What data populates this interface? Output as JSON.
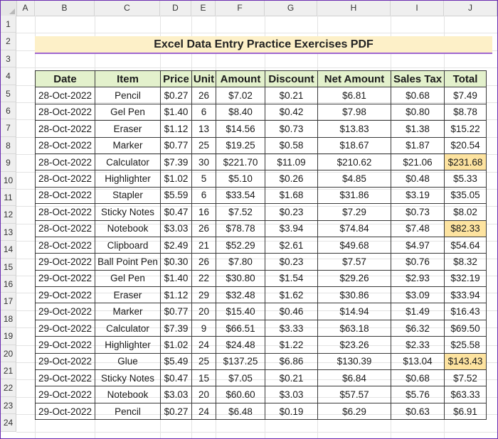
{
  "sheet": {
    "columns": [
      "A",
      "B",
      "C",
      "D",
      "E",
      "F",
      "G",
      "H",
      "I",
      "J"
    ],
    "rows": [
      "1",
      "2",
      "3",
      "4",
      "5",
      "6",
      "7",
      "8",
      "9",
      "10",
      "11",
      "12",
      "13",
      "14",
      "15",
      "16",
      "17",
      "18",
      "19",
      "20",
      "21",
      "22",
      "23",
      "24"
    ]
  },
  "title": "Excel Data Entry Practice Exercises PDF",
  "table": {
    "headers": [
      "Date",
      "Item",
      "Price",
      "Unit",
      "Amount",
      "Discount",
      "Net Amount",
      "Sales Tax",
      "Total"
    ],
    "highlight_color": "#fde3a0",
    "header_color": "#e3f1cc",
    "rows": [
      [
        "28-Oct-2022",
        "Pencil",
        "$0.27",
        "26",
        "$7.02",
        "$0.21",
        "$6.81",
        "$0.68",
        "$7.49"
      ],
      [
        "28-Oct-2022",
        "Gel Pen",
        "$1.40",
        "6",
        "$8.40",
        "$0.42",
        "$7.98",
        "$0.80",
        "$8.78"
      ],
      [
        "28-Oct-2022",
        "Eraser",
        "$1.12",
        "13",
        "$14.56",
        "$0.73",
        "$13.83",
        "$1.38",
        "$15.22"
      ],
      [
        "28-Oct-2022",
        "Marker",
        "$0.77",
        "25",
        "$19.25",
        "$0.58",
        "$18.67",
        "$1.87",
        "$20.54"
      ],
      [
        "28-Oct-2022",
        "Calculator",
        "$7.39",
        "30",
        "$221.70",
        "$11.09",
        "$210.62",
        "$21.06",
        "$231.68"
      ],
      [
        "28-Oct-2022",
        "Highlighter",
        "$1.02",
        "5",
        "$5.10",
        "$0.26",
        "$4.85",
        "$0.48",
        "$5.33"
      ],
      [
        "28-Oct-2022",
        "Stapler",
        "$5.59",
        "6",
        "$33.54",
        "$1.68",
        "$31.86",
        "$3.19",
        "$35.05"
      ],
      [
        "28-Oct-2022",
        "Sticky Notes",
        "$0.47",
        "16",
        "$7.52",
        "$0.23",
        "$7.29",
        "$0.73",
        "$8.02"
      ],
      [
        "28-Oct-2022",
        "Notebook",
        "$3.03",
        "26",
        "$78.78",
        "$3.94",
        "$74.84",
        "$7.48",
        "$82.33"
      ],
      [
        "28-Oct-2022",
        "Clipboard",
        "$2.49",
        "21",
        "$52.29",
        "$2.61",
        "$49.68",
        "$4.97",
        "$54.64"
      ],
      [
        "29-Oct-2022",
        "Ball Point Pen",
        "$0.30",
        "26",
        "$7.80",
        "$0.23",
        "$7.57",
        "$0.76",
        "$8.32"
      ],
      [
        "29-Oct-2022",
        "Gel Pen",
        "$1.40",
        "22",
        "$30.80",
        "$1.54",
        "$29.26",
        "$2.93",
        "$32.19"
      ],
      [
        "29-Oct-2022",
        "Eraser",
        "$1.12",
        "29",
        "$32.48",
        "$1.62",
        "$30.86",
        "$3.09",
        "$33.94"
      ],
      [
        "29-Oct-2022",
        "Marker",
        "$0.77",
        "20",
        "$15.40",
        "$0.46",
        "$14.94",
        "$1.49",
        "$16.43"
      ],
      [
        "29-Oct-2022",
        "Calculator",
        "$7.39",
        "9",
        "$66.51",
        "$3.33",
        "$63.18",
        "$6.32",
        "$69.50"
      ],
      [
        "29-Oct-2022",
        "Highlighter",
        "$1.02",
        "24",
        "$24.48",
        "$1.22",
        "$23.26",
        "$2.33",
        "$25.58"
      ],
      [
        "29-Oct-2022",
        "Glue",
        "$5.49",
        "25",
        "$137.25",
        "$6.86",
        "$130.39",
        "$13.04",
        "$143.43"
      ],
      [
        "29-Oct-2022",
        "Sticky Notes",
        "$0.47",
        "15",
        "$7.05",
        "$0.21",
        "$6.84",
        "$0.68",
        "$7.52"
      ],
      [
        "29-Oct-2022",
        "Notebook",
        "$3.03",
        "20",
        "$60.60",
        "$3.03",
        "$57.57",
        "$5.76",
        "$63.33"
      ],
      [
        "29-Oct-2022",
        "Pencil",
        "$0.27",
        "24",
        "$6.48",
        "$0.19",
        "$6.29",
        "$0.63",
        "$6.91"
      ]
    ],
    "highlighted_total_rows": [
      4,
      8,
      16
    ]
  }
}
